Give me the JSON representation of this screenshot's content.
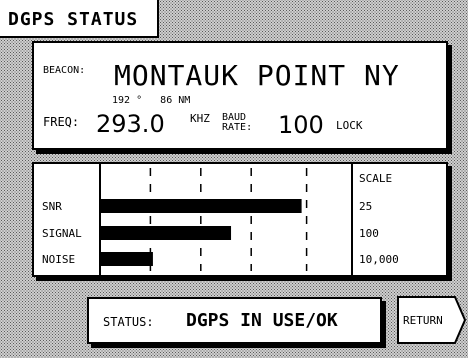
{
  "title": "DGPS STATUS",
  "beacon": {
    "label": "BEACON:",
    "name": "MONTAUK POINT NY",
    "bearing": "192 °",
    "distance": "86 NM",
    "freq_label": "FREQ:",
    "freq_value": "293.0",
    "freq_unit": "KHZ",
    "baud_label_1": "BAUD",
    "baud_label_2": "RATE:",
    "baud_value": "100",
    "lock": "LOCK"
  },
  "chart_data": {
    "type": "bar",
    "categories": [
      "SNR",
      "SIGNAL",
      "NOISE"
    ],
    "values": [
      0.8,
      0.52,
      0.21
    ],
    "value_unit": "fraction of scale",
    "scale_header": "SCALE",
    "scales": [
      "25",
      "100",
      "10,000"
    ],
    "gridlines": 4
  },
  "status": {
    "label": "STATUS:",
    "value": "DGPS IN USE/OK"
  },
  "return_label": "RETURN"
}
